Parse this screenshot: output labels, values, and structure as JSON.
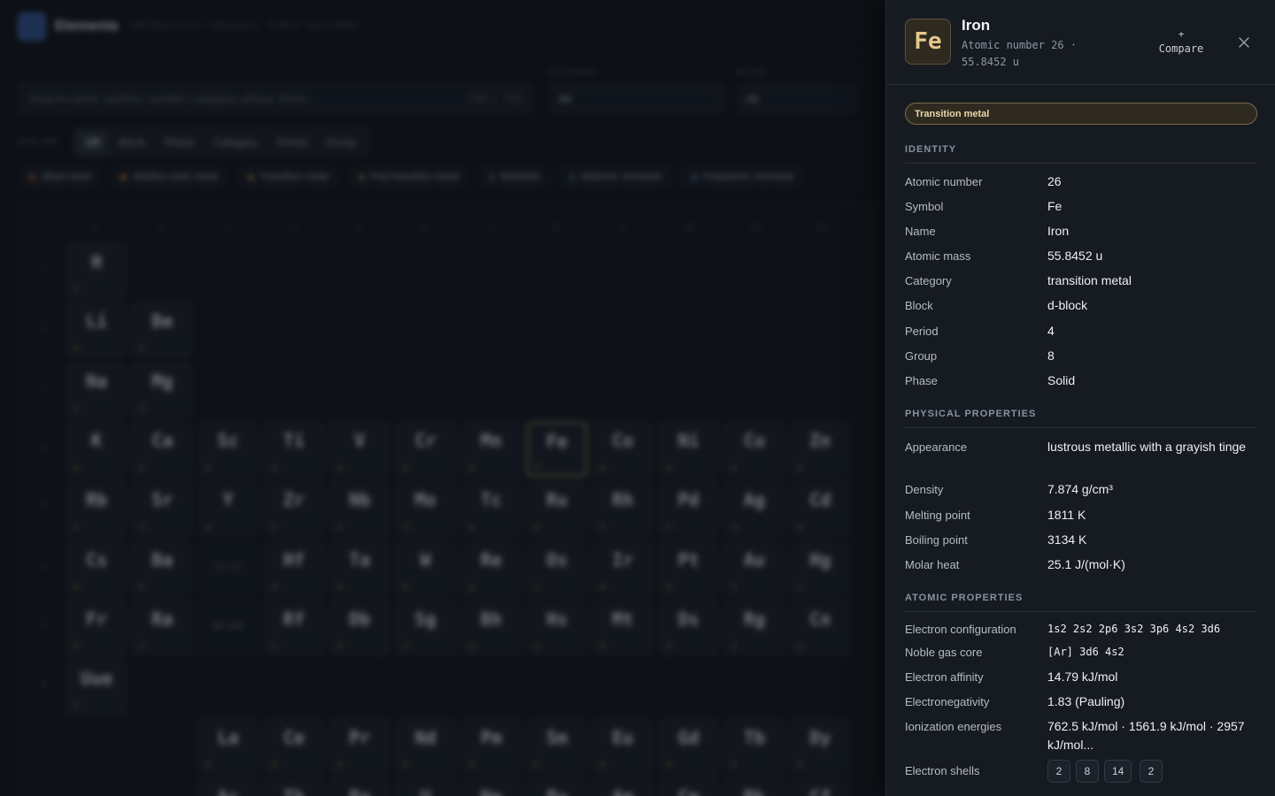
{
  "app": {
    "brand": "Elementa",
    "tagline": "INTERACTIVE PERIODIC TABLE EXPLORER"
  },
  "search": {
    "placeholder": "Search name, symbol, number, category, phase, block...",
    "count": "118 / 118"
  },
  "filters": {
    "category_label": "CATEGORY",
    "category_value": "All",
    "block_label": "BLOCK",
    "block_value": "All"
  },
  "explore": {
    "label": "EXPLORE",
    "options": [
      "Off",
      "Block",
      "Phase",
      "Category",
      "Period",
      "Group"
    ],
    "active": "Off"
  },
  "legend": [
    "Alkali metal",
    "Alkaline earth metal",
    "Transition metal",
    "Post-transition metal",
    "Metalloid",
    "Diatomic nonmetal",
    "Polyatomic nonmetal"
  ],
  "table": {
    "groups": [
      "1",
      "2",
      "3",
      "4",
      "5",
      "6",
      "7",
      "8",
      "9",
      "10",
      "11",
      "12"
    ],
    "periods": [
      "1",
      "2",
      "3",
      "4",
      "5",
      "6",
      "7",
      "8"
    ],
    "rows": [
      [
        "H"
      ],
      [
        "Li",
        "Be"
      ],
      [
        "Na",
        "Mg"
      ],
      [
        "K",
        "Ca",
        "Sc",
        "Ti",
        "V",
        "Cr",
        "Mn",
        "Fe",
        "Co",
        "Ni",
        "Cu",
        "Zn"
      ],
      [
        "Rb",
        "Sr",
        "Y",
        "Zr",
        "Nb",
        "Mo",
        "Tc",
        "Ru",
        "Rh",
        "Pd",
        "Ag",
        "Cd"
      ],
      [
        "Cs",
        "Ba",
        "57-71",
        "Hf",
        "Ta",
        "W",
        "Re",
        "Os",
        "Ir",
        "Pt",
        "Au",
        "Hg"
      ],
      [
        "Fr",
        "Ra",
        "89-103",
        "Rf",
        "Db",
        "Sg",
        "Bh",
        "Hs",
        "Mt",
        "Ds",
        "Rg",
        "Cn"
      ],
      [
        "Uue"
      ]
    ],
    "lanthanides": [
      "La",
      "Ce",
      "Pr",
      "Nd",
      "Pm",
      "Sm",
      "Eu",
      "Gd",
      "Tb",
      "Dy"
    ],
    "actinides": [
      "Ac",
      "Th",
      "Pa",
      "U",
      "Np",
      "Pu",
      "Am",
      "Cm",
      "Bk",
      "Cf"
    ]
  },
  "drawer": {
    "symbol": "Fe",
    "name": "Iron",
    "subtitle": "Atomic number 26 · 55.8452 u",
    "compare_plus": "+",
    "compare_label": "Compare",
    "close_icon": "close-icon",
    "category_badge": "Transition metal",
    "accent_color": "#e5c88a",
    "identity": {
      "title": "IDENTITY",
      "rows": [
        {
          "label": "Atomic number",
          "value": "26"
        },
        {
          "label": "Symbol",
          "value": "Fe"
        },
        {
          "label": "Name",
          "value": "Iron"
        },
        {
          "label": "Atomic mass",
          "value": "55.8452 u"
        },
        {
          "label": "Category",
          "value": "transition metal"
        },
        {
          "label": "Block",
          "value": "d-block"
        },
        {
          "label": "Period",
          "value": "4"
        },
        {
          "label": "Group",
          "value": "8"
        },
        {
          "label": "Phase",
          "value": "Solid"
        }
      ]
    },
    "physical": {
      "title": "PHYSICAL PROPERTIES",
      "rows": [
        {
          "label": "Appearance",
          "value": "lustrous metallic with a grayish tinge"
        },
        {
          "label": "Density",
          "value": "7.874 g/cm³"
        },
        {
          "label": "Melting point",
          "value": "1811 K"
        },
        {
          "label": "Boiling point",
          "value": "3134 K"
        },
        {
          "label": "Molar heat",
          "value": "25.1 J/(mol·K)"
        }
      ]
    },
    "atomic": {
      "title": "ATOMIC PROPERTIES",
      "rows": [
        {
          "label": "Electron configuration",
          "value": "1s2 2s2 2p6 3s2 3p6 4s2 3d6"
        },
        {
          "label": "Noble gas core",
          "value": "[Ar] 3d6 4s2"
        },
        {
          "label": "Electron affinity",
          "value": "14.79 kJ/mol"
        },
        {
          "label": "Electronegativity",
          "value": "1.83 (Pauling)"
        },
        {
          "label": "Ionization energies",
          "value": "762.5 kJ/mol · 1561.9 kJ/mol · 2957 kJ/mol..."
        },
        {
          "label": "Electron shells",
          "value": ""
        }
      ],
      "shells": [
        "2",
        "8",
        "14",
        "2"
      ]
    }
  }
}
